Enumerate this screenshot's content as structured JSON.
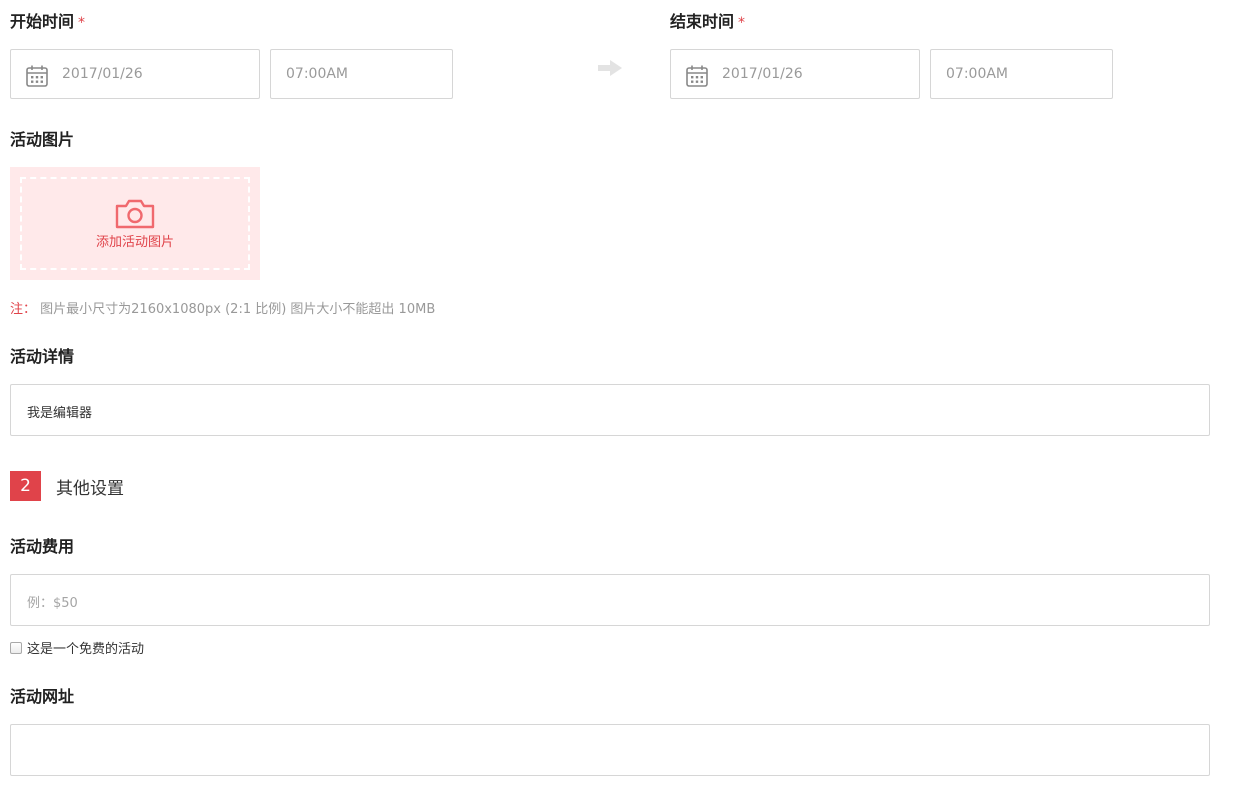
{
  "start": {
    "label": "开始时间",
    "required_mark": "*",
    "date": "2017/01/26",
    "time": "07:00AM"
  },
  "end": {
    "label": "结束时间",
    "required_mark": "*",
    "date": "2017/01/26",
    "time": "07:00AM"
  },
  "image_section": {
    "label": "活动图片",
    "upload_text": "添加活动图片",
    "note_key": "注：",
    "note_text": "图片最小尺寸为2160x1080px (2:1 比例) 图片大小不能超出 10MB"
  },
  "details": {
    "label": "活动详情",
    "editor_text": "我是编辑器"
  },
  "step": {
    "number": "2",
    "title": "其他设置"
  },
  "fee": {
    "label": "活动费用",
    "placeholder": "例：$50",
    "free_checkbox_label": "这是一个免费的活动",
    "free_checked": false
  },
  "url": {
    "label": "活动网址",
    "value": ""
  },
  "colors": {
    "accent": "#e0434a",
    "upload_bg": "#ffe9ea",
    "border": "#d6d6d6"
  },
  "icons": {
    "calendar": "calendar-icon",
    "arrow": "arrow-right-icon",
    "camera": "camera-icon"
  }
}
